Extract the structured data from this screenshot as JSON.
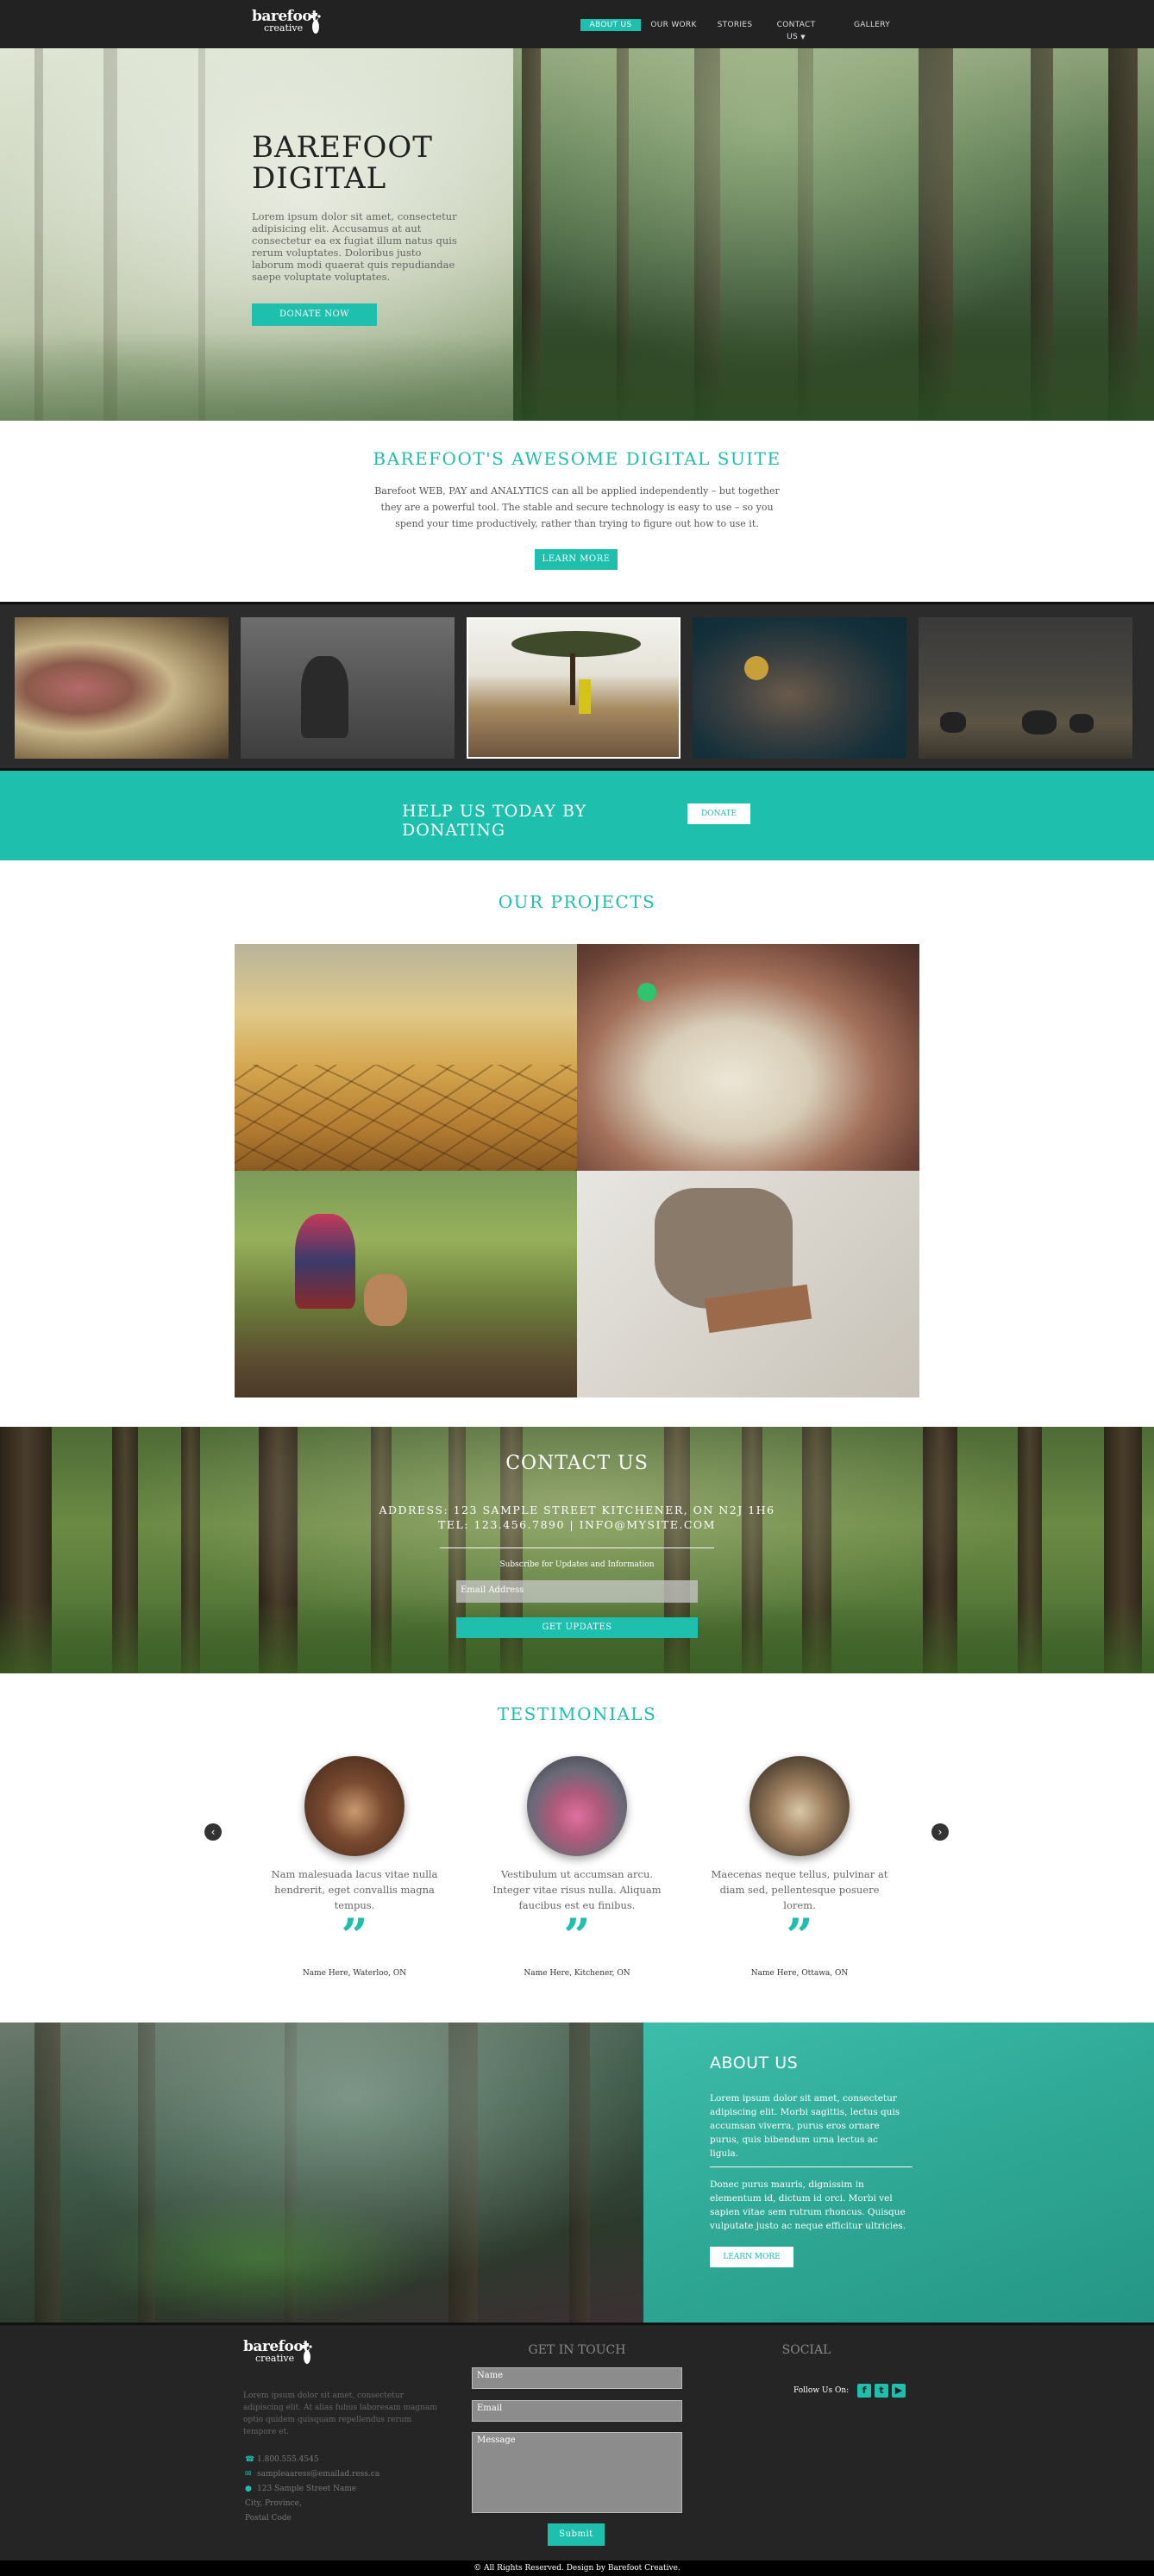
{
  "nav": {
    "logo_line1": "barefoot",
    "logo_line2": "creative",
    "items": [
      {
        "label": "ABOUT US"
      },
      {
        "label": "OUR WORK"
      },
      {
        "label": "STORIES"
      },
      {
        "label": "CONTACT US"
      },
      {
        "label": "GALLERY"
      }
    ],
    "dropdown_icon": "caret-down-icon"
  },
  "hero": {
    "title_line1": "BAREFOOT",
    "title_line2": "DIGITAL",
    "text": "Lorem ipsum dolor sit amet, consectetur adipisicing elit. Accusamus at aut consectetur ea ex fugiat illum natus quis rerum voluptates. Doloribus justo laborum modi quaerat quis repudiandae saepe voluptate voluptates.",
    "button": "DONATE NOW"
  },
  "suite": {
    "title": "BAREFOOT'S AWESOME DIGITAL SUITE",
    "text": "Barefoot WEB, PAY and ANALYTICS can all be applied independently – but together they are a powerful tool. The stable and secure technology is easy to use – so you spend your time productively, rather than trying to figure out how to use it.",
    "button": "LEARN MORE"
  },
  "donate_band": {
    "heading": "HELP US TODAY BY DONATING",
    "button": "DONATE"
  },
  "projects": {
    "title": "OUR PROJECTS"
  },
  "contact": {
    "title": "CONTACT US",
    "address": "ADDRESS: 123 SAMPLE STREET KITCHENER, ON N2J 1H6",
    "tel": "TEL: 123.456.7890 | INFO@MYSITE.COM",
    "subscribe_label": "Subscribe for Updates and Information",
    "email_placeholder": "Email Address",
    "button": "GET UPDATES"
  },
  "testimonials": {
    "title": "TESTIMONIALS",
    "items": [
      {
        "text": "Nam malesuada lacus vitae nulla hendrerit, eget convallis magna tempus.",
        "name": "Name Here, Waterloo, ON"
      },
      {
        "text": "Vestibulum ut accumsan arcu. Integer vitae risus nulla. Aliquam faucibus est eu finibus.",
        "name": "Name Here, Kitchener, ON"
      },
      {
        "text": "Maecenas neque tellus, pulvinar at diam sed, pellentesque posuere lorem.",
        "name": "Name Here, Ottawa, ON"
      }
    ],
    "prev": "‹",
    "next": "›"
  },
  "about": {
    "title": "ABOUT US",
    "para1": "Lorem ipsum dolor sit amet, consectetur adipiscing elit. Morbi sagittis, lectus quis accumsan viverra, purus eros ornare purus, quis bibendum urna lectus ac ligula.",
    "para2": "Donec purus mauris, dignissim in elementum id, dictum id orci. Morbi vel sapien vitae sem rutrum rhoncus. Quisque vulputate justo ac neque efficitur ultricies.",
    "button": "LEARN MORE"
  },
  "footer": {
    "logo_line1": "barefoot",
    "logo_line2": "creative",
    "text": "Lorem ipsum dolor sit amet, consectetur adipiscing elit. At alias fuhus laboresam magnam optio quidem quisquam repellendus rerum tempore et.",
    "phone": "1.800.555.4545",
    "email": "sampleaaress@emailad.ress.ca",
    "address_lines": [
      "123 Sample Street Name",
      "City, Province,",
      "Postal Code"
    ],
    "get_in_touch": "GET IN TOUCH",
    "name_placeholder": "Name",
    "email_placeholder": "Email",
    "message_placeholder": "Message",
    "submit": "Submit",
    "social_title": "SOCIAL",
    "follow_label": "Follow Us On:",
    "social_icons": [
      "facebook-icon",
      "twitter-icon",
      "youtube-icon"
    ],
    "copyright": "© All Rights Reserved. Design by Barefoot Creative."
  },
  "colors": {
    "accent": "#1fbfae",
    "nav_bg": "#222222",
    "footer_bg": "#252525"
  }
}
